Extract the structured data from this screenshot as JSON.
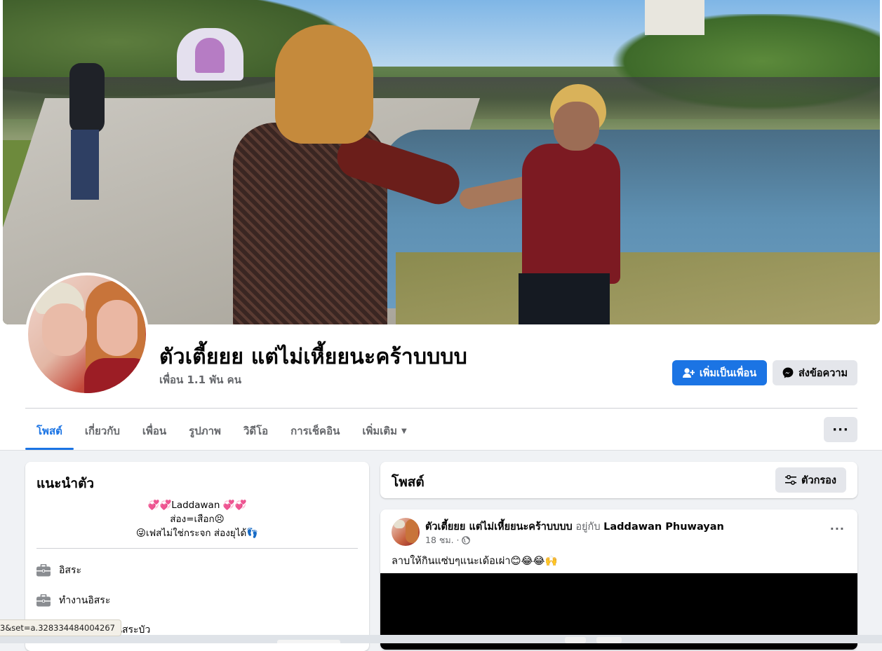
{
  "profile": {
    "name": "ตัวเตี้ยยย แต่ไม่เหี้ยยนะคร้าบบบบ",
    "friends": "เพื่อน 1.1 พัน คน"
  },
  "actions": {
    "add_friend": "เพิ่มเป็นเพื่อน",
    "message": "ส่งข้อความ",
    "more": "···"
  },
  "tabs": [
    {
      "label": "โพสต์",
      "active": true
    },
    {
      "label": "เกี่ยวกับ"
    },
    {
      "label": "เพื่อน"
    },
    {
      "label": "รูปภาพ"
    },
    {
      "label": "วิดีโอ"
    },
    {
      "label": "การเช็คอิน"
    },
    {
      "label": "เพิ่มเติม",
      "caret": "▼"
    }
  ],
  "intro": {
    "title": "แนะนำตัว",
    "bio": [
      "💞💞Laddawan 💞💞",
      "ส่อง=เสือก😣",
      "😜เฟสไม่ใช่กระจก ส่องยุได้👣"
    ],
    "info": [
      {
        "icon": "briefcase-icon",
        "text": "อิสระ"
      },
      {
        "icon": "briefcase-icon",
        "text": "ทำงานอิสระ"
      },
      {
        "icon": "home-icon",
        "text": "อาศัยอยู่ที่ บ้านสระบัว"
      }
    ]
  },
  "posts": {
    "title": "โพสต์",
    "filter_label": "ตัวกรอง",
    "items": [
      {
        "author": "ตัวเตี้ยยย แต่ไม่เหี้ยยนะคร้าบบบบ",
        "with_text": "อยู่กับ",
        "tagged": "Laddawan Phuwayan",
        "time": "18 ชม. ·",
        "text": "ลาบให้กินแซ่บๆแนะเด้อเผ่า😊😂😂🙌",
        "more": "···"
      }
    ]
  },
  "status_bar": {
    "url": "3&set=a.328334484004267"
  },
  "colors": {
    "accent": "#1b74e4",
    "background": "#f0f2f5",
    "secondary_button": "#e4e6eb",
    "muted_text": "#65676b"
  }
}
